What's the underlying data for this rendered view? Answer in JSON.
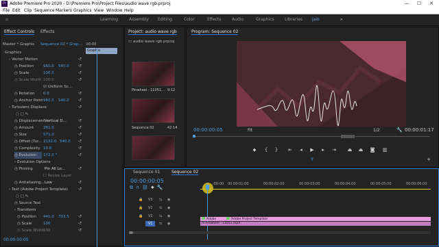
{
  "titlebar": {
    "title": "Adobe Premiere Pro 2020 - D:\\Premiere Pro\\Project Files\\audio wave rgb.prproj",
    "min": "—",
    "max": "☐",
    "close": "✕"
  },
  "menu": [
    "File",
    "Edit",
    "Clip",
    "Sequence",
    "Markers",
    "Graphics",
    "View",
    "Window",
    "Help"
  ],
  "workspaces": [
    "Learning",
    "Assembly",
    "Editing",
    "Color",
    "Effects",
    "Audio",
    "Graphics",
    "Libraries",
    "jaio"
  ],
  "active_workspace": "jaio",
  "more": "»",
  "effect_controls": {
    "tab": "Effect Controls",
    "tab2": "Effects",
    "master": "Master * Graphic",
    "seq": "Sequence 02 * Grap...",
    "timecode_head": "00:00",
    "clip_label": "Graphic",
    "section": "Graphics",
    "vector_motion": "Vector Motion",
    "position_label": "Position",
    "position_x": "960.0",
    "position_y": "540.0",
    "scale_label": "Scale",
    "scale_val": "100.0",
    "scale_width_label": "Scale Width",
    "scale_width_val": "100.0",
    "uniform_label": "Uniform Sc...",
    "rotation_label": "Rotation",
    "rotation_val": "0.0",
    "anchor_label": "Anchor Point",
    "anchor_x": "960.0",
    "anchor_y": "540.0",
    "turbulent": "Turbulent Displace",
    "displacement_label": "Displacement",
    "displacement_val": "Vertical D...",
    "amount_label": "Amount",
    "amount_val": "261.0",
    "size_label": "Size",
    "size_val": "571.0",
    "offset_label": "Offset (Tur...",
    "offset_x": "2132.0",
    "offset_y": "540.0",
    "complexity_label": "Complexity",
    "complexity_val": "10.0",
    "evolution_label": "Evolution",
    "evolution_val": "172.0 °",
    "evolution_opts": "Evolution Options",
    "pinning_label": "Pinning",
    "pinning_val": "Pin All Lo...",
    "resize_label": "Resize Layer",
    "antialias_label": "Antialiasing...",
    "antialias_val": "Low",
    "text_label": "Text (Adobe Project Template)",
    "source_text": "Source Text",
    "transform": "Transform",
    "t_position_label": "Position",
    "t_position_x": "441.0",
    "t_position_y": "703.5",
    "t_scale_label": "Scale",
    "t_scale_val": "100",
    "t_scale_w_label": "Scale Width",
    "t_scale_w_val": "100",
    "timecode": "00:00:00:05"
  },
  "project": {
    "tab": "Project: audio wave rgb",
    "file": "audio wave rgb.prproj",
    "items": [
      {
        "name": "Pinwheel - 11051...",
        "dur": "9:12"
      },
      {
        "name": "Sequence 02",
        "dur": "42:14"
      },
      {
        "name": "",
        "dur": ""
      }
    ]
  },
  "program": {
    "tab": "Program: Sequence 02",
    "timecode": "00:00:00:05",
    "fit": "Fit",
    "ratio": "1/2",
    "duration": "00:00:01:17"
  },
  "timeline": {
    "tabs": [
      "Sequence 01",
      "Sequence 02"
    ],
    "timecode": "00:00:00:05",
    "ruler": [
      ":00:00",
      "00:00:01:00",
      "00:00:02:00",
      "00:00:03:00",
      "00:00:04:00",
      "00:00:05:00",
      "00:00:06:00"
    ],
    "tracks": [
      "V3",
      "V2",
      "V1"
    ],
    "clip_a": "Adobe",
    "clip_b": "Adobe Project Template",
    "clip_c": "Pinwheel - 11051.mp4",
    "fx": "fx"
  },
  "colors": {
    "accent": "#2f7ad8",
    "clip_pink": "#e79be0",
    "clip_green": "#6fcf6f",
    "playhead": "#4d9de0"
  }
}
